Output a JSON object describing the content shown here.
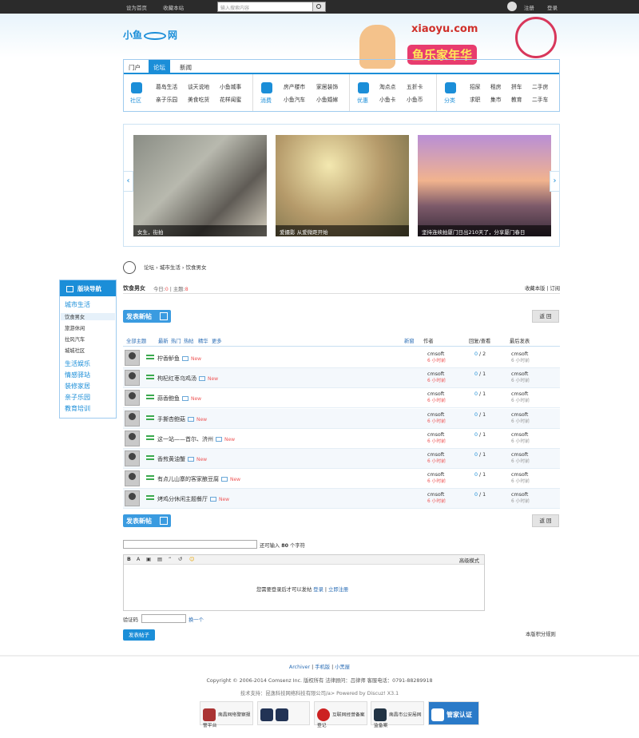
{
  "topbar": {
    "set_home": "设为首页",
    "favorite": "收藏本站",
    "search_placeholder": "输入搜索内容",
    "register": "注册",
    "login": "登录"
  },
  "logo": {
    "text1": "小鱼",
    "text2": "网"
  },
  "promo": {
    "site": "xiaoyu.com",
    "title": "鱼乐家年华"
  },
  "nav": {
    "tabs": [
      "门户",
      "论坛",
      "新闻"
    ],
    "groups": [
      {
        "name": "社区",
        "items": [
          "葛岛生活",
          "谈天说地",
          "小鱼城事",
          "亲子乐园",
          "美食吃货",
          "花样闺蜜"
        ]
      },
      {
        "name": "消费",
        "items": [
          "房产楼市",
          "家居装饰",
          "小鱼汽车",
          "小鱼婚嫁"
        ]
      },
      {
        "name": "优惠",
        "items": [
          "淘点点",
          "五折卡",
          "小鱼卡",
          "小鱼币"
        ]
      },
      {
        "name": "分类",
        "items": [
          "招尿",
          "租房",
          "拼车",
          "二手房",
          "求职",
          "集市",
          "教育",
          "二手车"
        ]
      }
    ]
  },
  "slides": [
    {
      "caption": "女生，街拍"
    },
    {
      "caption": "爱摄影 从爱微距开始"
    },
    {
      "caption": "坚持连续拍厦门日出210天了，分享厦门春日"
    }
  ],
  "breadcrumb": [
    "论坛",
    "城市生活",
    "饮食男女"
  ],
  "sidebar": {
    "title": "版块导航",
    "city": "城市生活",
    "subs": [
      "饮食男女",
      "旅游休闲",
      "拉风汽车",
      "城城社区"
    ],
    "groups": [
      "生活娱乐",
      "情感驿站",
      "装修家居",
      "亲子乐园",
      "教育培训"
    ]
  },
  "forum": {
    "name": "饮食男女",
    "today_label": "今日:",
    "today": "0",
    "topics_label": "主题:",
    "topics": "8",
    "favorite": "收藏本版",
    "subscribe": "订阅",
    "post_btn": "发表新帖",
    "back": "返 回"
  },
  "filter": {
    "all": "全部主题",
    "latest": "最新",
    "hot": "热门",
    "heat": "热帖",
    "digest": "精华",
    "more": "更多",
    "new_window": "新窗",
    "author": "作者",
    "reply_view": "回复/查看",
    "last_post": "最后发表"
  },
  "threads": [
    {
      "title": "柠香鲈鱼",
      "author": "cmsoft",
      "time": "6 小时前",
      "replies": "0",
      "views": "2",
      "last": "cmsoft",
      "last_time": "6 小时前"
    },
    {
      "title": "枸杞红枣乌鸡汤",
      "author": "cmsoft",
      "time": "6 小时前",
      "replies": "0",
      "views": "1",
      "last": "cmsoft",
      "last_time": "6 小时前"
    },
    {
      "title": "蒜香鲍鱼",
      "author": "cmsoft",
      "time": "6 小时前",
      "replies": "0",
      "views": "1",
      "last": "cmsoft",
      "last_time": "6 小时前"
    },
    {
      "title": "手撕杏鲍菇",
      "author": "cmsoft",
      "time": "6 小时前",
      "replies": "0",
      "views": "1",
      "last": "cmsoft",
      "last_time": "6 小时前"
    },
    {
      "title": "这一站——首尔、济州",
      "author": "cmsoft",
      "time": "6 小时前",
      "replies": "0",
      "views": "1",
      "last": "cmsoft",
      "last_time": "6 小时前"
    },
    {
      "title": "香煎黄油蟹",
      "author": "cmsoft",
      "time": "6 小时前",
      "replies": "0",
      "views": "1",
      "last": "cmsoft",
      "last_time": "6 小时前"
    },
    {
      "title": "有点儿山寨的客家酿豆腐",
      "author": "cmsoft",
      "time": "6 小时前",
      "replies": "0",
      "views": "1",
      "last": "cmsoft",
      "last_time": "6 小时前"
    },
    {
      "title": "烤鸡分休闲主题餐厅",
      "author": "cmsoft",
      "time": "6 小时前",
      "replies": "0",
      "views": "1",
      "last": "cmsoft",
      "last_time": "6 小时前"
    }
  ],
  "new_label": "New",
  "quickpost": {
    "hint_prefix": "还可输入",
    "hint_num": "80",
    "hint_suffix": "个字符",
    "advanced": "高级模式",
    "login_msg": "您需要登录后才可以发帖",
    "login": "登录",
    "sep": "|",
    "register": "立即注册",
    "captcha": "验证码",
    "change": "换一个",
    "submit": "发表帖子",
    "rules": "本版积分规则"
  },
  "footer": {
    "links": [
      "Archiver",
      "手机版",
      "小黑屋"
    ],
    "copyright": "Copyright © 2006-2014  Comsenz Inc. 版权所有  法律顾问：吕律师  客服电话：0791-88289918",
    "support": "技术支持：昆逸科技网络科技有限公司/a>  Powered by Discuz! X3.1",
    "badges": [
      "南昌网络警察报警平台",
      "",
      "互联网经营备案登记",
      "南昌市公安局网监备案",
      "管家认证"
    ]
  }
}
